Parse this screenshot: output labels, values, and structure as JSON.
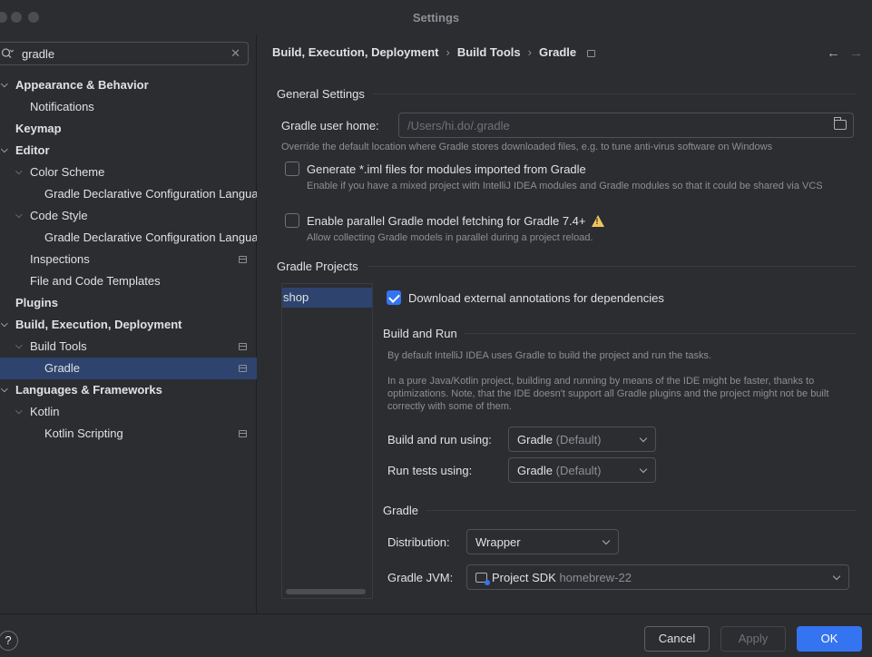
{
  "window": {
    "title": "Settings"
  },
  "search": {
    "value": "gradle"
  },
  "tree": {
    "appearance": "Appearance & Behavior",
    "notifications": "Notifications",
    "keymap": "Keymap",
    "editor": "Editor",
    "color_scheme": "Color Scheme",
    "gradle_decl_1": "Gradle Declarative Configuration Language",
    "code_style": "Code Style",
    "gradle_decl_2": "Gradle Declarative Configuration Language",
    "inspections": "Inspections",
    "file_templates": "File and Code Templates",
    "plugins": "Plugins",
    "build_exec": "Build, Execution, Deployment",
    "build_tools": "Build Tools",
    "gradle": "Gradle",
    "languages": "Languages & Frameworks",
    "kotlin": "Kotlin",
    "kotlin_scripting": "Kotlin Scripting"
  },
  "breadcrumb": {
    "item1": "Build, Execution, Deployment",
    "item2": "Build Tools",
    "item3": "Gradle"
  },
  "general": {
    "title": "General Settings",
    "user_home_label": "Gradle user home:",
    "user_home_placeholder": "/Users/hi.do/.gradle",
    "user_home_hint": "Override the default location where Gradle stores downloaded files, e.g. to tune anti-virus software on Windows",
    "gen_iml_label": "Generate *.iml files for modules imported from Gradle",
    "gen_iml_hint": "Enable if you have a mixed project with IntelliJ IDEA modules and Gradle modules so that it could be shared via VCS",
    "parallel_label": "Enable parallel Gradle model fetching for Gradle 7.4+",
    "parallel_hint": "Allow collecting Gradle models in parallel during a project reload."
  },
  "projects": {
    "title": "Gradle Projects",
    "items": [
      "shop"
    ],
    "download_annotations": "Download external annotations for dependencies"
  },
  "build_run": {
    "title": "Build and Run",
    "hint1": "By default IntelliJ IDEA uses Gradle to build the project and run the tasks.",
    "hint2": "In a pure Java/Kotlin project, building and running by means of the IDE might be faster, thanks to optimizations. Note, that the IDE doesn't support all Gradle plugins and the project might not be built correctly with some of them.",
    "build_using_label": "Build and run using:",
    "build_using_value": "Gradle",
    "build_using_suffix": "(Default)",
    "tests_using_label": "Run tests using:",
    "tests_using_value": "Gradle",
    "tests_using_suffix": "(Default)"
  },
  "gradle_section": {
    "title": "Gradle",
    "distribution_label": "Distribution:",
    "distribution_value": "Wrapper",
    "jvm_label": "Gradle JVM:",
    "jvm_value": "Project SDK",
    "jvm_suffix": "homebrew-22"
  },
  "buttons": {
    "help": "?",
    "cancel": "Cancel",
    "apply": "Apply",
    "ok": "OK"
  },
  "colors": {
    "accent": "#3574f0",
    "selection": "#2e436e",
    "background": "#2b2d30",
    "warning": "#f2c55c"
  }
}
